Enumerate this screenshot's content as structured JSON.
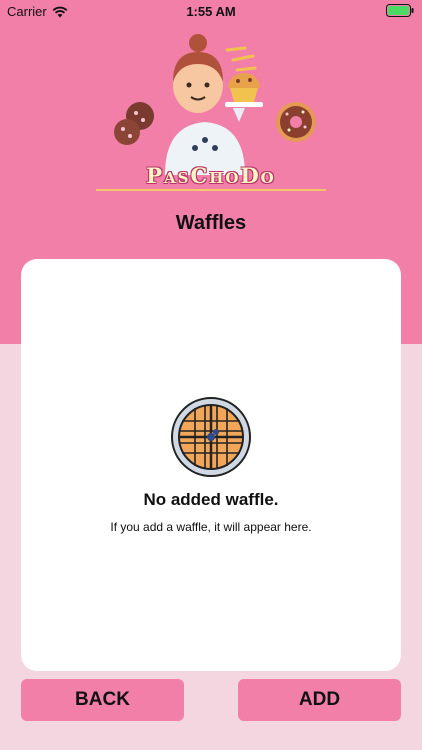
{
  "status_bar": {
    "carrier": "Carrier",
    "time": "1:55 AM",
    "icons": [
      "wifi-icon",
      "battery-icon"
    ]
  },
  "header": {
    "brand": "PasChoDo",
    "title": "Waffles",
    "illustration": "chef-with-pastries-icon"
  },
  "empty_state": {
    "icon": "waffle-icon",
    "title": "No added waffle.",
    "description": "If you add a waffle, it will appear here."
  },
  "actions": {
    "back_label": "BACK",
    "add_label": "ADD"
  },
  "colors": {
    "header_background": "#f27fa8",
    "page_background": "#f3d6e0",
    "button_background": "#f27fa8",
    "card_background": "#ffffff"
  }
}
